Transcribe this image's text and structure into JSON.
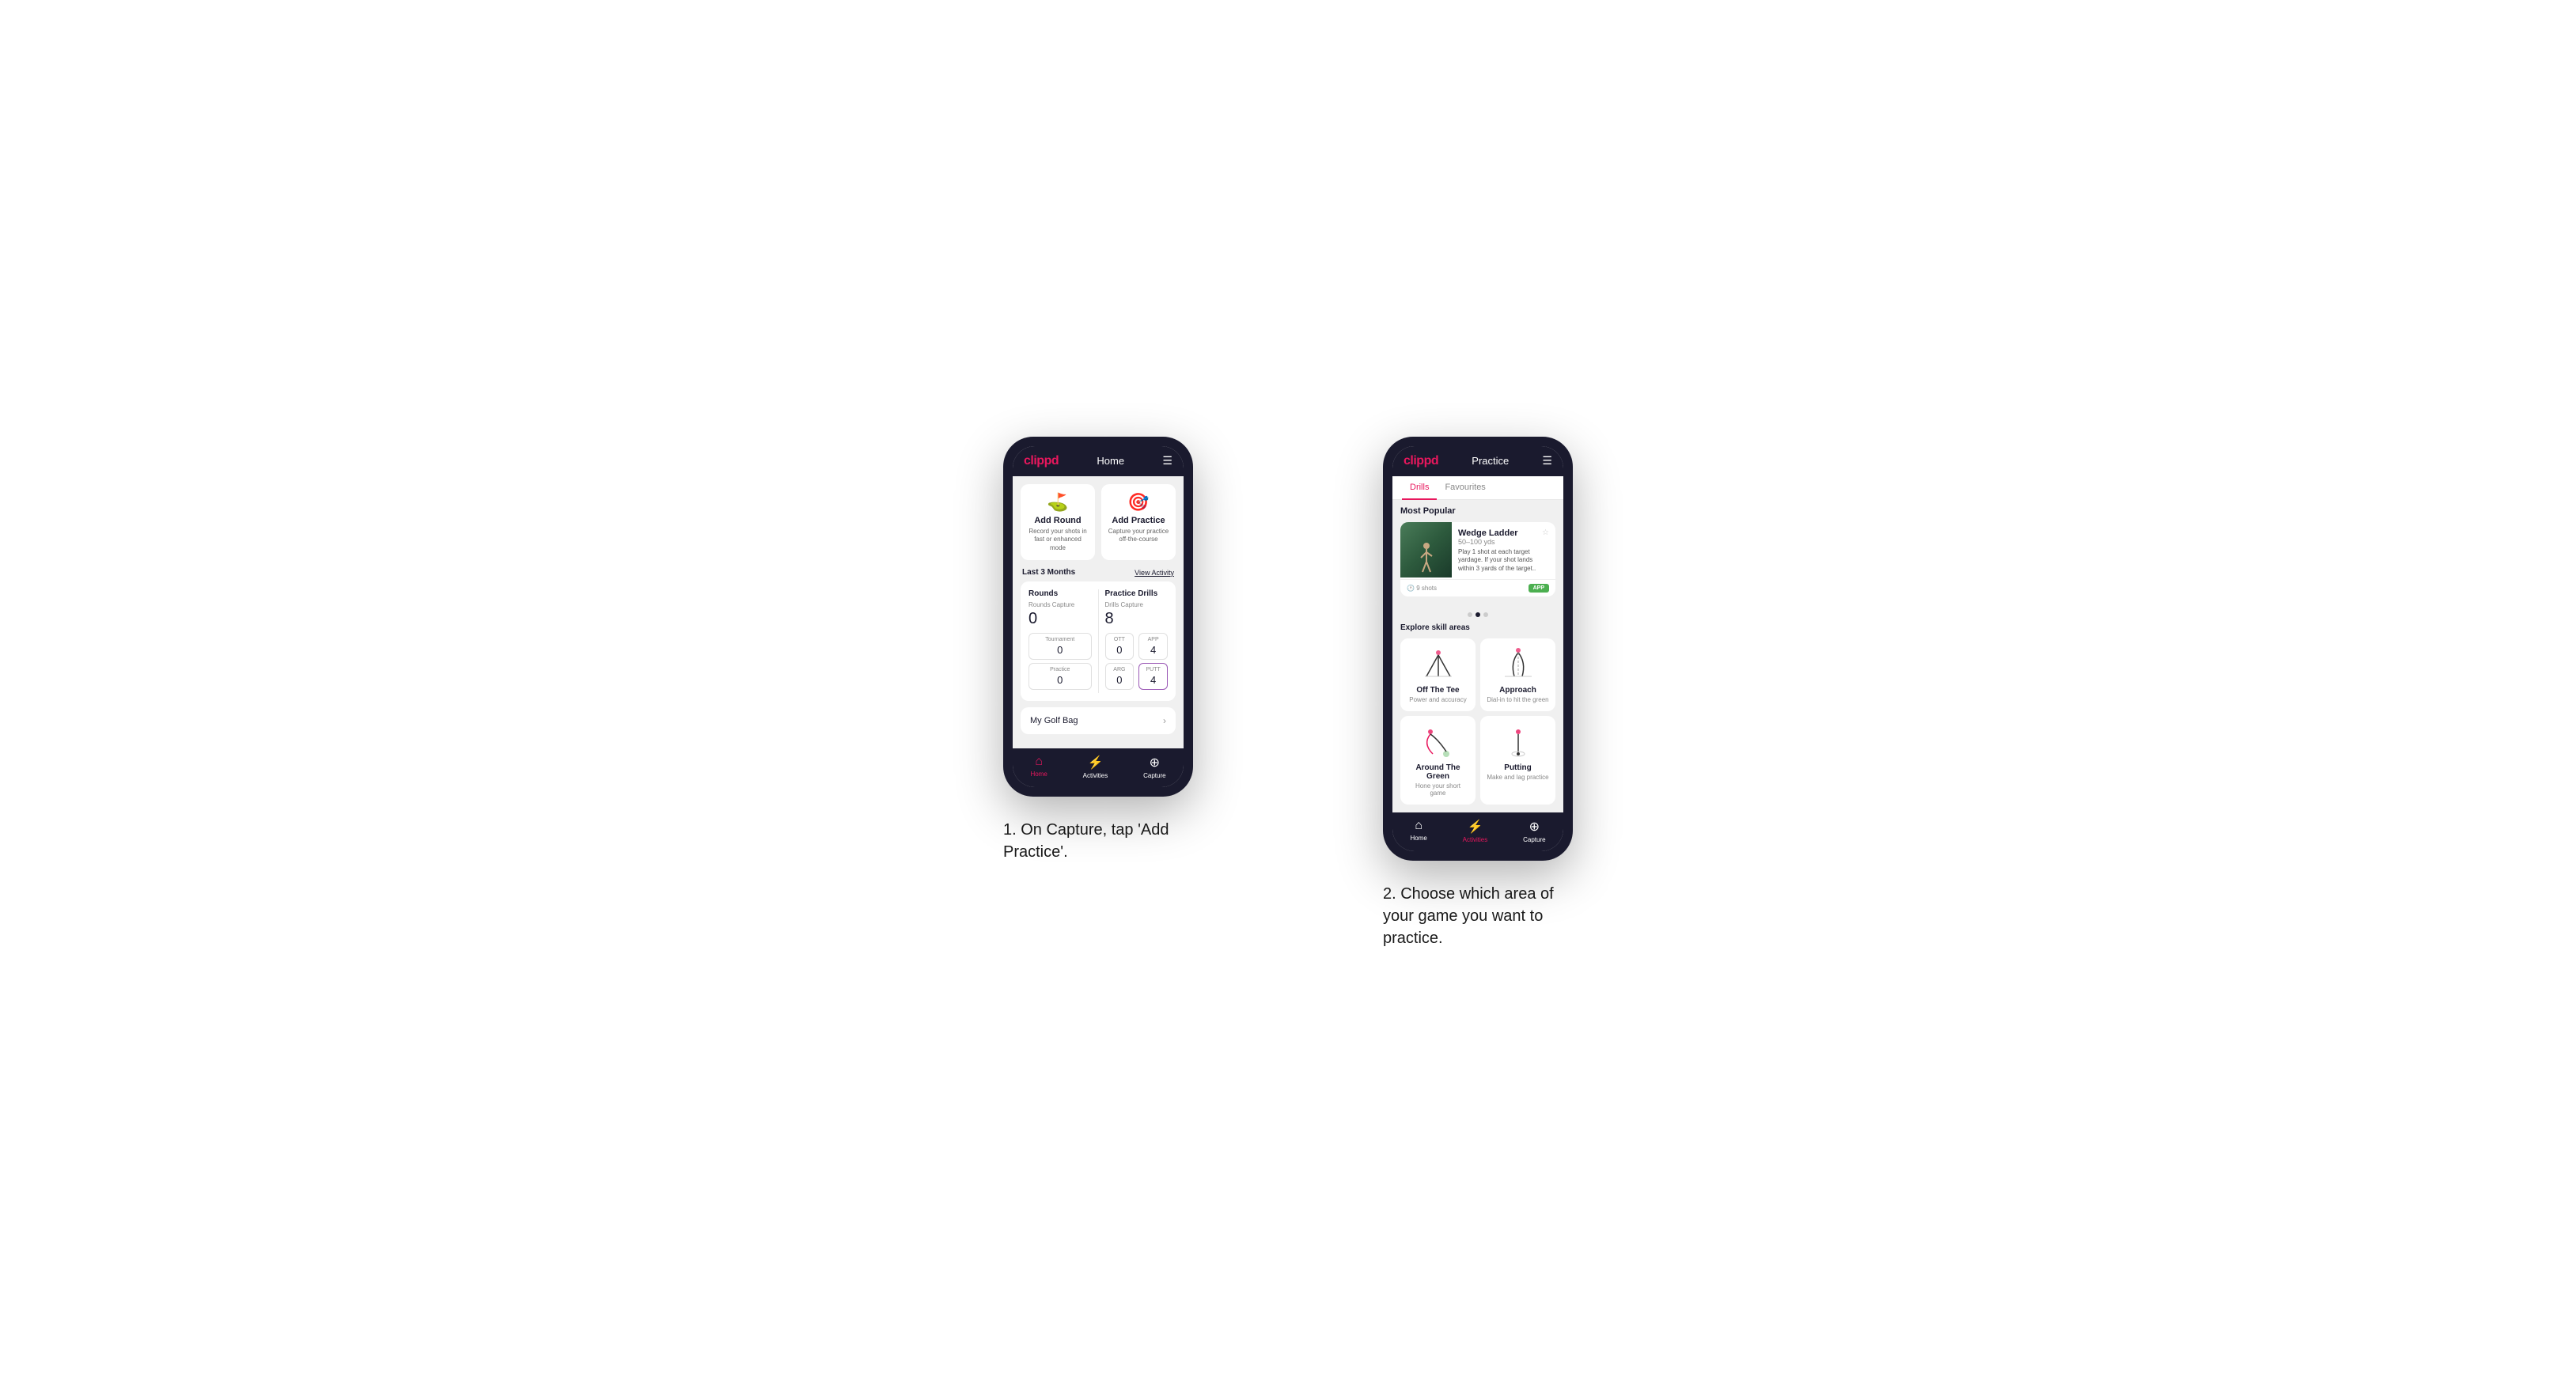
{
  "phone1": {
    "header": {
      "logo": "clippd",
      "title": "Home",
      "menu_icon": "☰"
    },
    "action_cards": [
      {
        "id": "add-round",
        "icon": "⛳",
        "title": "Add Round",
        "description": "Record your shots in fast or enhanced mode"
      },
      {
        "id": "add-practice",
        "icon": "🎯",
        "title": "Add Practice",
        "description": "Capture your practice off-the-course"
      }
    ],
    "stats": {
      "period": "Last 3 Months",
      "view_activity": "View Activity",
      "rounds": {
        "title": "Rounds",
        "captures_label": "Rounds Capture",
        "captures_value": "0",
        "tournament_label": "Tournament",
        "tournament_value": "0",
        "practice_label": "Practice",
        "practice_value": "0"
      },
      "practice_drills": {
        "title": "Practice Drills",
        "captures_label": "Drills Capture",
        "captures_value": "8",
        "ott_label": "OTT",
        "ott_value": "0",
        "app_label": "APP",
        "app_value": "4",
        "arg_label": "ARG",
        "arg_value": "0",
        "putt_label": "PUTT",
        "putt_value": "4"
      }
    },
    "golf_bag": {
      "label": "My Golf Bag"
    },
    "bottom_nav": [
      {
        "id": "home",
        "icon": "🏠",
        "label": "Home",
        "active": true
      },
      {
        "id": "activities",
        "icon": "⚡",
        "label": "Activities",
        "active": false
      },
      {
        "id": "capture",
        "icon": "➕",
        "label": "Capture",
        "active": false
      }
    ]
  },
  "phone2": {
    "header": {
      "logo": "clippd",
      "title": "Practice",
      "menu_icon": "☰"
    },
    "tabs": [
      {
        "label": "Drills",
        "active": true
      },
      {
        "label": "Favourites",
        "active": false
      }
    ],
    "most_popular": {
      "title": "Most Popular",
      "card": {
        "title": "Wedge Ladder",
        "subtitle": "50–100 yds",
        "description": "Play 1 shot at each target yardage. If your shot lands within 3 yards of the target..",
        "shots": "9 shots",
        "badge": "APP"
      },
      "dots": [
        false,
        true,
        false
      ]
    },
    "explore": {
      "title": "Explore skill areas",
      "skills": [
        {
          "id": "off-the-tee",
          "name": "Off The Tee",
          "description": "Power and accuracy"
        },
        {
          "id": "approach",
          "name": "Approach",
          "description": "Dial-in to hit the green"
        },
        {
          "id": "around-the-green",
          "name": "Around The Green",
          "description": "Hone your short game"
        },
        {
          "id": "putting",
          "name": "Putting",
          "description": "Make and lag practice"
        }
      ]
    },
    "bottom_nav": [
      {
        "id": "home",
        "icon": "🏠",
        "label": "Home",
        "active": false
      },
      {
        "id": "activities",
        "icon": "⚡",
        "label": "Activities",
        "active": true
      },
      {
        "id": "capture",
        "icon": "➕",
        "label": "Capture",
        "active": false
      }
    ]
  },
  "captions": {
    "caption1": "1. On Capture, tap 'Add Practice'.",
    "caption2": "2. Choose which area of your game you want to practice."
  },
  "colors": {
    "brand_pink": "#e8175d",
    "dark_navy": "#1a1a2e",
    "app_green": "#4CAF50"
  }
}
